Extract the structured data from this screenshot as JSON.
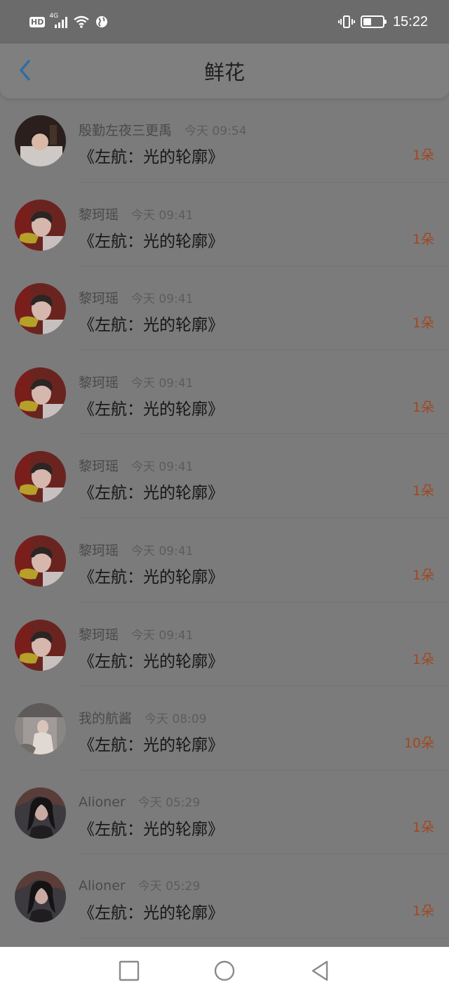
{
  "status_bar": {
    "hd": "HD",
    "network": "4G",
    "time": "15:22"
  },
  "header": {
    "title": "鲜花"
  },
  "colors": {
    "accent_back": "#2f6da3",
    "count_color": "#a1471f"
  },
  "entries": [
    {
      "name": "殷勤左夜三更禹",
      "time": "今天 09:54",
      "book": "《左航：光的轮廓》",
      "count": "1朵",
      "avatar": "avatar-boy-dark"
    },
    {
      "name": "黎珂瑶",
      "time": "今天 09:41",
      "book": "《左航：光的轮廓》",
      "count": "1朵",
      "avatar": "avatar-boy-red"
    },
    {
      "name": "黎珂瑶",
      "time": "今天 09:41",
      "book": "《左航：光的轮廓》",
      "count": "1朵",
      "avatar": "avatar-boy-red"
    },
    {
      "name": "黎珂瑶",
      "time": "今天 09:41",
      "book": "《左航：光的轮廓》",
      "count": "1朵",
      "avatar": "avatar-boy-red"
    },
    {
      "name": "黎珂瑶",
      "time": "今天 09:41",
      "book": "《左航：光的轮廓》",
      "count": "1朵",
      "avatar": "avatar-boy-red"
    },
    {
      "name": "黎珂瑶",
      "time": "今天 09:41",
      "book": "《左航：光的轮廓》",
      "count": "1朵",
      "avatar": "avatar-boy-red"
    },
    {
      "name": "黎珂瑶",
      "time": "今天 09:41",
      "book": "《左航：光的轮廓》",
      "count": "1朵",
      "avatar": "avatar-boy-red"
    },
    {
      "name": "我的航酱",
      "time": "今天 08:09",
      "book": "《左航：光的轮廓》",
      "count": "10朵",
      "avatar": "avatar-girl-light"
    },
    {
      "name": "Alioner",
      "time": "今天 05:29",
      "book": "《左航：光的轮廓》",
      "count": "1朵",
      "avatar": "avatar-girl-dark"
    },
    {
      "name": "Alioner",
      "time": "今天 05:29",
      "book": "《左航：光的轮廓》",
      "count": "1朵",
      "avatar": "avatar-girl-dark"
    }
  ],
  "nav": {
    "icons": [
      "square-icon",
      "circle-icon",
      "triangle-back-icon"
    ]
  }
}
